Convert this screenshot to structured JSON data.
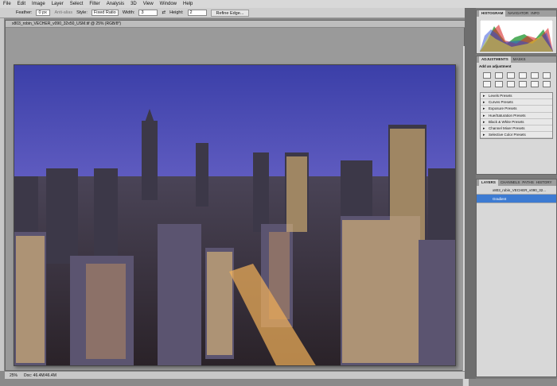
{
  "menu": [
    "File",
    "Edit",
    "Image",
    "Layer",
    "Select",
    "Filter",
    "Analysis",
    "3D",
    "View",
    "Window",
    "Help"
  ],
  "options": {
    "feather_label": "Feather:",
    "feather_value": "0 px",
    "antialias": "Anti-alias",
    "style_label": "Style:",
    "style_value": "Fixed Ratio",
    "width_label": "Width:",
    "width_value": "3",
    "height_label": "Height:",
    "height_value": "2",
    "refine_edge": "Refine Edge..."
  },
  "document": {
    "tab_title": "x803_robin_VECHER_v090_32x50_USM.tif @ 25% (RGB/8*)",
    "zoom": "25%",
    "doc_info": "Doc: 46.4M/46.4M"
  },
  "panels": {
    "histogram_tabs": [
      "HISTOGRAM",
      "NAVIGATOR",
      "INFO"
    ],
    "adjust_tabs": [
      "ADJUSTMENTS",
      "MASKS"
    ],
    "adjust_heading": "Add an adjustment",
    "presets": [
      "Levels Presets",
      "Curves Presets",
      "Exposure Presets",
      "Hue/Saturation Presets",
      "Black & White Presets",
      "Channel Mixer Presets",
      "Selective Color Presets"
    ],
    "layers_tabs": [
      "LAYERS",
      "CHANNELS",
      "PATHS",
      "HISTORY"
    ],
    "layers": [
      "x803_robin_VECHER_v090_32...",
      "Gradient"
    ]
  },
  "colors": {
    "accent": "#3d7bd2",
    "sky": "#3a3f9e"
  }
}
